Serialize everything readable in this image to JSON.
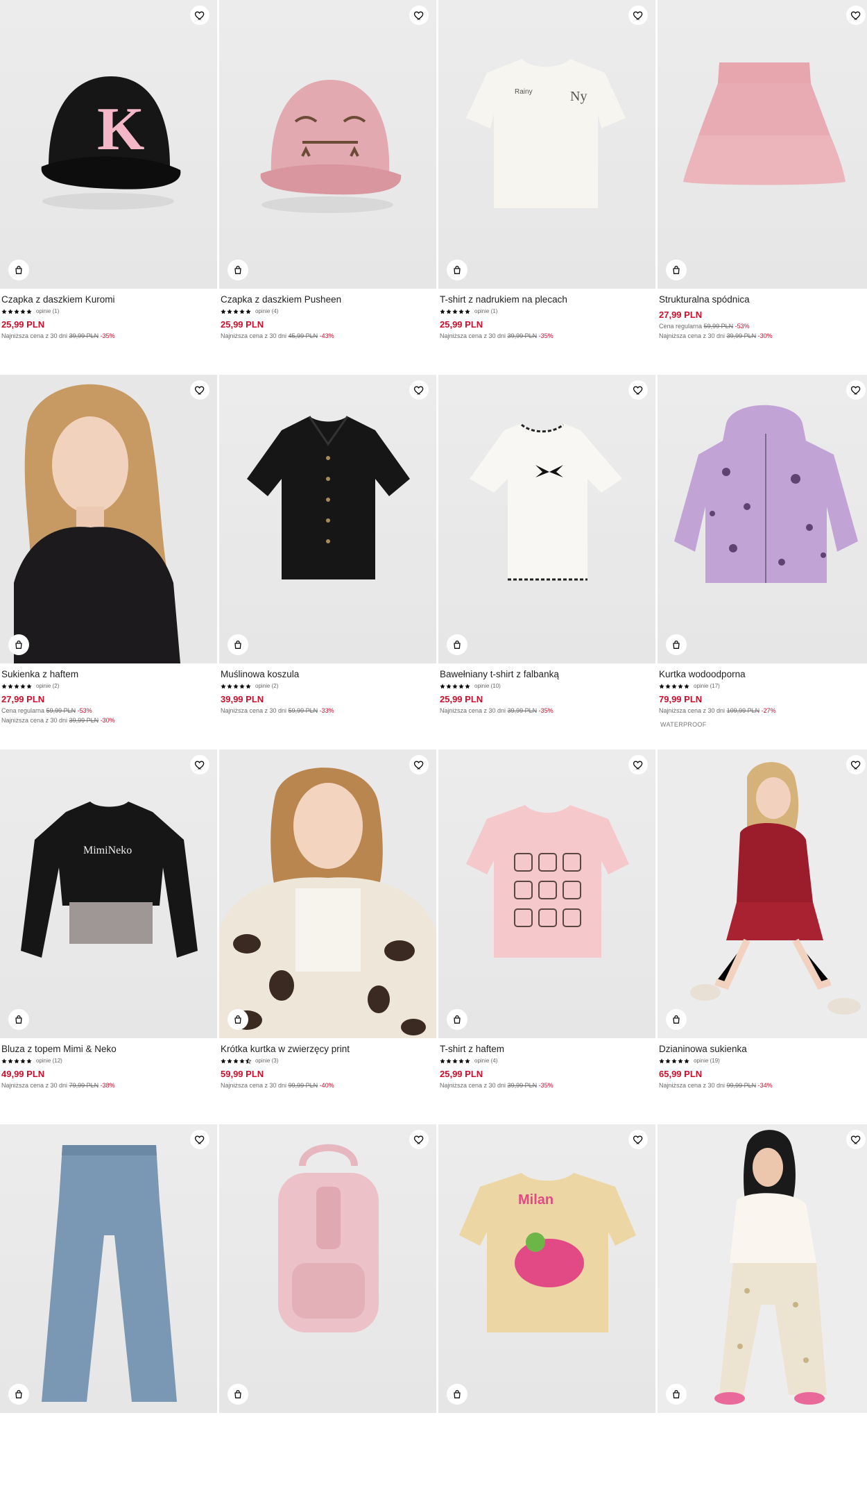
{
  "labels": {
    "lowest_price_prefix": "Najniższa cena z 30 dni",
    "regular_price_prefix": "Cena regularna"
  },
  "colors": {
    "sale": "#c8102e",
    "background": "#e8e8e8"
  },
  "products": [
    {
      "name": "Czapka z daszkiem Kuromi",
      "stars": 5,
      "reviews": "opinie (1)",
      "price": "25,99 PLN",
      "lowest_old": "39,99 PLN",
      "lowest_disc": "-35%",
      "art": "cap-black"
    },
    {
      "name": "Czapka z daszkiem Pusheen",
      "stars": 5,
      "reviews": "opinie (4)",
      "price": "25,99 PLN",
      "lowest_old": "45,99 PLN",
      "lowest_disc": "-43%",
      "art": "cap-pink"
    },
    {
      "name": "T-shirt z nadrukiem na plecach",
      "stars": 5,
      "reviews": "opinie (1)",
      "price": "25,99 PLN",
      "lowest_old": "39,99 PLN",
      "lowest_disc": "-35%",
      "art": "tee-white"
    },
    {
      "name": "Strukturalna spódnica",
      "stars": 0,
      "reviews": "",
      "price": "27,99 PLN",
      "regular_old": "59,99 PLN",
      "regular_disc": "-53%",
      "lowest_old": "39,99 PLN",
      "lowest_disc": "-30%",
      "art": "skirt-pink"
    },
    {
      "name": "Sukienka z haftem",
      "stars": 5,
      "reviews": "opinie (2)",
      "price": "27,99 PLN",
      "regular_old": "59,99 PLN",
      "regular_disc": "-53%",
      "lowest_old": "39,99 PLN",
      "lowest_disc": "-30%",
      "art": "girl-black-dress"
    },
    {
      "name": "Muślinowa koszula",
      "stars": 5,
      "reviews": "opinie (2)",
      "price": "39,99 PLN",
      "lowest_old": "59,99 PLN",
      "lowest_disc": "-33%",
      "art": "shirt-black"
    },
    {
      "name": "Bawełniany t-shirt z falbanką",
      "stars": 5,
      "reviews": "opinie (10)",
      "price": "25,99 PLN",
      "lowest_old": "39,99 PLN",
      "lowest_disc": "-35%",
      "art": "tee-ruffle"
    },
    {
      "name": "Kurtka wodoodporna",
      "stars": 5,
      "reviews": "opinie (17)",
      "price": "79,99 PLN",
      "lowest_old": "109,99 PLN",
      "lowest_disc": "-27%",
      "tag": "WATERPROOF",
      "art": "jacket-lilac"
    },
    {
      "name": "Bluza z topem Mimi & Neko",
      "stars": 5,
      "reviews": "opinie (12)",
      "price": "49,99 PLN",
      "lowest_old": "79,99 PLN",
      "lowest_disc": "-38%",
      "art": "sweat-black"
    },
    {
      "name": "Krótka kurtka w zwierzęcy print",
      "stars": 4.5,
      "reviews": "opinie (3)",
      "price": "59,99 PLN",
      "lowest_old": "99,99 PLN",
      "lowest_disc": "-40%",
      "art": "girl-cow-jacket"
    },
    {
      "name": "T-shirt z haftem",
      "stars": 5,
      "reviews": "opinie (4)",
      "price": "25,99 PLN",
      "lowest_old": "39,99 PLN",
      "lowest_disc": "-35%",
      "art": "tee-pink"
    },
    {
      "name": "Dzianinowa sukienka",
      "stars": 5,
      "reviews": "opinie (19)",
      "price": "65,99 PLN",
      "lowest_old": "99,99 PLN",
      "lowest_disc": "-34%",
      "art": "girl-red-dress"
    },
    {
      "name": "",
      "stars": 0,
      "reviews": "",
      "price": "",
      "art": "jeans"
    },
    {
      "name": "",
      "stars": 0,
      "reviews": "",
      "price": "",
      "art": "backpack"
    },
    {
      "name": "",
      "stars": 0,
      "reviews": "",
      "price": "",
      "art": "tee-beige"
    },
    {
      "name": "",
      "stars": 0,
      "reviews": "",
      "price": "",
      "art": "girl-floral-pants"
    }
  ]
}
